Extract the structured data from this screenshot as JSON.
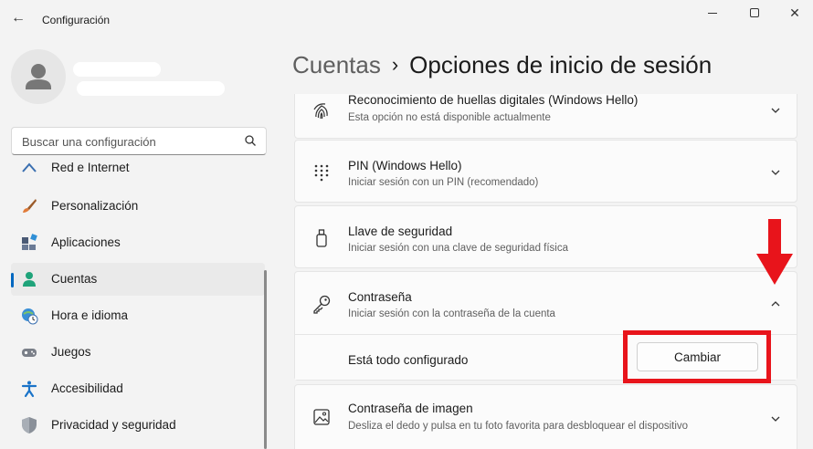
{
  "window": {
    "title": "Configuración"
  },
  "sidebar": {
    "search_placeholder": "Buscar una configuración",
    "items": [
      {
        "label": "Red e Internet",
        "icon": "network-icon"
      },
      {
        "label": "Personalización",
        "icon": "brush-icon"
      },
      {
        "label": "Aplicaciones",
        "icon": "apps-icon"
      },
      {
        "label": "Cuentas",
        "icon": "person-icon",
        "selected": true
      },
      {
        "label": "Hora e idioma",
        "icon": "globe-clock-icon"
      },
      {
        "label": "Juegos",
        "icon": "gamepad-icon"
      },
      {
        "label": "Accesibilidad",
        "icon": "accessibility-icon"
      },
      {
        "label": "Privacidad y seguridad",
        "icon": "shield-icon"
      }
    ]
  },
  "breadcrumb": {
    "parent": "Cuentas",
    "separator": "›",
    "current": "Opciones de inicio de sesión"
  },
  "cards": [
    {
      "title": "Reconocimiento de huellas digitales (Windows Hello)",
      "desc": "Esta opción no está disponible actualmente",
      "icon": "fingerprint-icon",
      "expanded": false
    },
    {
      "title": "PIN (Windows Hello)",
      "desc": "Iniciar sesión con un PIN (recomendado)",
      "icon": "pin-keypad-icon",
      "expanded": false
    },
    {
      "title": "Llave de seguridad",
      "desc": "Iniciar sesión con una clave de seguridad física",
      "icon": "usb-key-icon",
      "expanded": false
    },
    {
      "title": "Contraseña",
      "desc": "Iniciar sesión con la contraseña de la cuenta",
      "icon": "key-icon",
      "expanded": true,
      "detail": {
        "label": "Está todo configurado",
        "button": "Cambiar"
      }
    },
    {
      "title": "Contraseña de imagen",
      "desc": "Desliza el dedo y pulsa en tu foto favorita para desbloquear el dispositivo",
      "icon": "picture-icon",
      "expanded": false
    }
  ],
  "colors": {
    "accent": "#0067c0",
    "annotation": "#e8141b"
  }
}
